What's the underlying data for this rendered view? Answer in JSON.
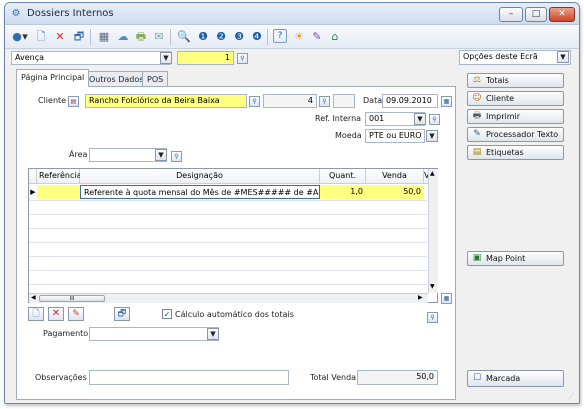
{
  "window": {
    "title": "Dossiers Internos",
    "minimize": "–",
    "maximize": "□",
    "close": "✕"
  },
  "toolbar": {
    "icons": [
      "●",
      "▾",
      "🗋",
      "✕",
      "🗗",
      "▦",
      "☁",
      "🖶",
      "✉",
      "🔍",
      "❶",
      "❷",
      "❸",
      "❹",
      "?",
      "☀",
      "✎",
      "⌂"
    ]
  },
  "header": {
    "doc_type": "Avença",
    "number": "1"
  },
  "options_select": "Opções deste Ecrã",
  "tabs": [
    {
      "label": "Página Principal"
    },
    {
      "label": "Outros Dados"
    },
    {
      "label": "POS"
    }
  ],
  "form": {
    "cliente_label": "Cliente",
    "cliente_name": "Rancho Folclórico da Beira Baixa",
    "cliente_number": "4",
    "data_label": "Data",
    "data_value": "09.09.2010",
    "ref_label": "Ref. Interna",
    "ref_value": "001",
    "moeda_label": "Moeda",
    "moeda_value": "PTE ou EURO",
    "area_label": "Área",
    "area_value": ""
  },
  "grid": {
    "headers": [
      "Referência",
      "Designação",
      "Quant.",
      "Venda",
      "V"
    ],
    "row": {
      "referencia": "",
      "designacao": "Referente à quota mensal do Mês de #MES##### de #ANO#",
      "quant": "1,0",
      "venda": "50,0"
    },
    "scroll_label": "III"
  },
  "below_grid": {
    "auto_calc_label": "Cálculo automático dos totais",
    "auto_calc_checked": "✓",
    "pagamento_label": "Pagamento",
    "pagamento_value": "",
    "observacoes_label": "Observações",
    "observacoes_value": "",
    "total_label": "Total Venda",
    "total_value": "50,0"
  },
  "side_buttons": [
    {
      "label": "Totais",
      "icon": "⚖"
    },
    {
      "label": "Cliente",
      "icon": "☺"
    },
    {
      "label": "Imprimir",
      "icon": "🖶"
    },
    {
      "label": "Processador Texto",
      "icon": "✎"
    },
    {
      "label": "Etiquetas",
      "icon": "▤"
    }
  ],
  "map_point": {
    "label": "Map Point",
    "icon": "▣"
  },
  "marcada": {
    "label": "Marcada",
    "icon": "☐"
  }
}
